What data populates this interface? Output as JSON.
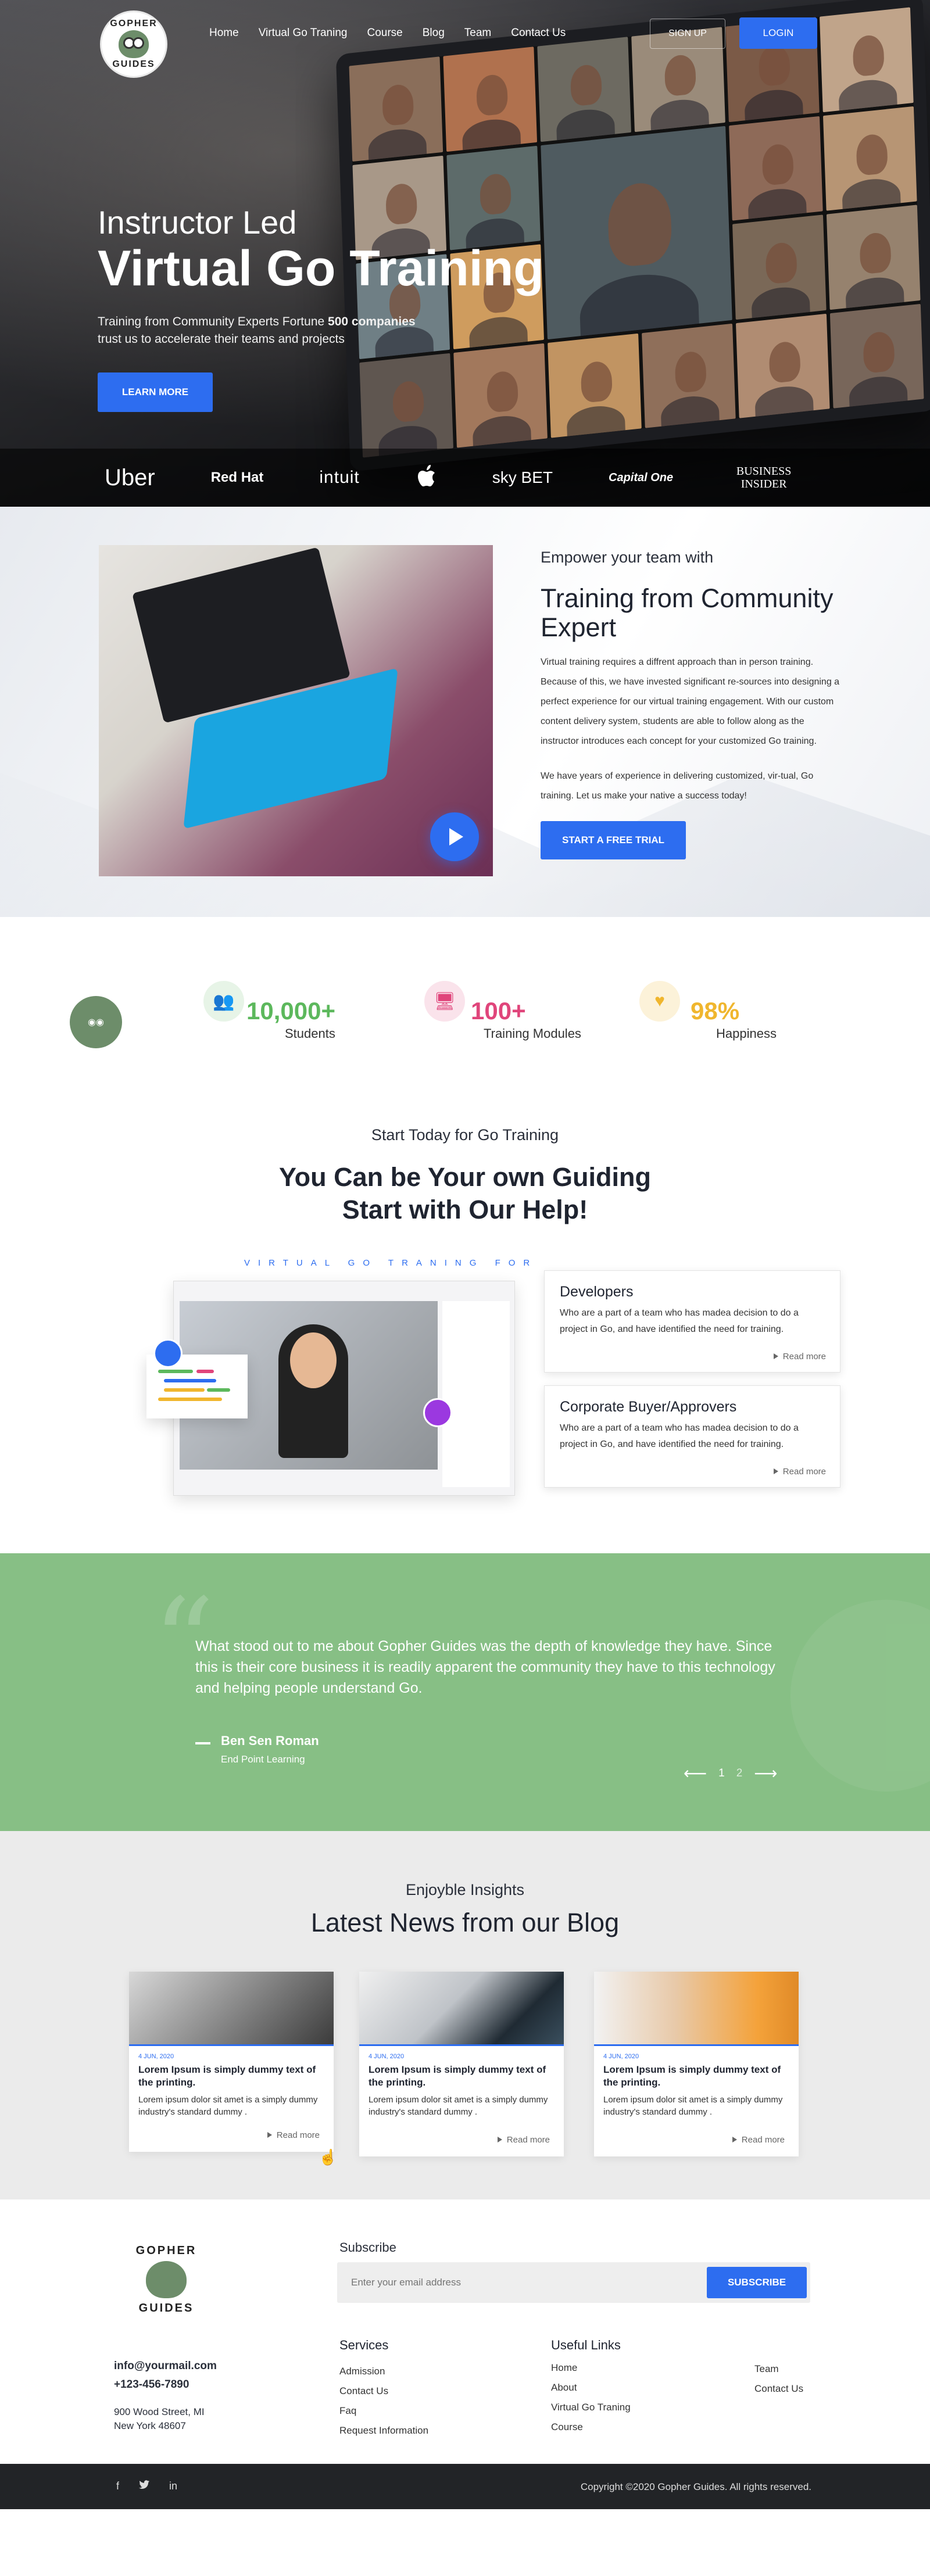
{
  "nav": {
    "logo_text_top": "GOPHER",
    "logo_text_bottom": "GUIDES",
    "menu": [
      "Home",
      "Virtual Go Traning",
      "Course",
      "Blog",
      "Team",
      "Contact Us"
    ],
    "signup": "SIGN UP",
    "login": "LOGIN"
  },
  "hero": {
    "subtitle": "Instructor Led",
    "title": "Virtual Go Training",
    "text_line1_pre": "Training from Community Experts Fortune ",
    "text_line1_bold": "500 companies",
    "text_line2": "trust us to accelerate their teams and projects",
    "cta": "LEARN MORE",
    "brands": [
      "Uber",
      "Red Hat",
      "intuit",
      "",
      "sky BET",
      "Capital One",
      "BUSINESS INSIDER"
    ]
  },
  "about": {
    "kicker": "Empower your team with",
    "title": "Training from Community Expert",
    "p1": "Virtual training requires a diffrent approach than in person training. Because of this, we have invested significant re-sources into designing a perfect experience for our virtual training engagement. With our custom content delivery system, students are able to follow along as the instructor introduces each concept for your customized Go training.",
    "p2": "We have years of experience in delivering customized, vir-tual, Go training. Let us make your native a success today!",
    "cta": "START A FREE TRIAL"
  },
  "stats": [
    {
      "num": "10,000+",
      "label": "Students",
      "color": "#5cb85c"
    },
    {
      "num": "100+",
      "label": "Training Modules",
      "color": "#e0457b"
    },
    {
      "num": "98%",
      "label": "Happiness",
      "color": "#f0b62e"
    }
  ],
  "guiding": {
    "kicker": "Start Today for Go Training",
    "title_line1": "You Can be Your own Guiding",
    "title_line2": "Start with Our Help!",
    "label": "VIRTUAL GO TRANING FOR",
    "roles": [
      {
        "title": "Developers",
        "text": "Who are a part of a team who has madea decision to do a project in Go, and have identified the need for training.",
        "link": "Read more"
      },
      {
        "title": "Corporate Buyer/Approvers",
        "text": "Who are a part of a team who has madea decision to do a project in Go, and have identified the need for training.",
        "link": "Read more"
      }
    ]
  },
  "testimonial": {
    "quote": "What stood out to me about Gopher Guides was the depth of knowledge they have. Since this is their core business it is readily apparent the community they have to this technology and helping people understand Go.",
    "author": "Ben Sen Roman",
    "org": "End Point Learning",
    "prev": "⟵",
    "page1": "1",
    "page2": "2",
    "next": "⟶"
  },
  "blog": {
    "kicker": "Enjoyble Insights",
    "title": "Latest News from our Blog",
    "posts": [
      {
        "date": "4 JUN, 2020",
        "title": "Lorem Ipsum is simply dummy text of the printing.",
        "text": "Lorem ipsum dolor sit amet is a simply dummy industry's standard dummy .",
        "link": "Read more"
      },
      {
        "date": "4 JUN, 2020",
        "title": "Lorem Ipsum is simply dummy text of the printing.",
        "text": "Lorem ipsum dolor sit amet is a simply dummy industry's standard dummy .",
        "link": "Read more"
      },
      {
        "date": "4 JUN, 2020",
        "title": "Lorem Ipsum is simply dummy text of the printing.",
        "text": "Lorem ipsum dolor sit amet is a simply dummy industry's standard dummy .",
        "link": "Read more"
      }
    ]
  },
  "footer": {
    "email": "info@yourmail.com",
    "phone": "+123-456-7890",
    "address_line1": "900 Wood Street, MI",
    "address_line2": "New York 48607",
    "subscribe_title": "Subscribe",
    "subscribe_placeholder": "Enter your email address",
    "subscribe_button": "SUBSCRIBE",
    "services_title": "Services",
    "services": [
      "Admission",
      "Contact Us",
      "Faq",
      "Request Information"
    ],
    "useful_title": "Useful Links",
    "useful_col1": [
      "Home",
      "About",
      "Virtual Go Traning",
      "Course"
    ],
    "useful_col2": [
      "Team",
      "Contact Us"
    ],
    "social": [
      "f",
      "t",
      "in"
    ],
    "copyright": "Copyright ©2020 Gopher Guides.  All rights reserved."
  }
}
